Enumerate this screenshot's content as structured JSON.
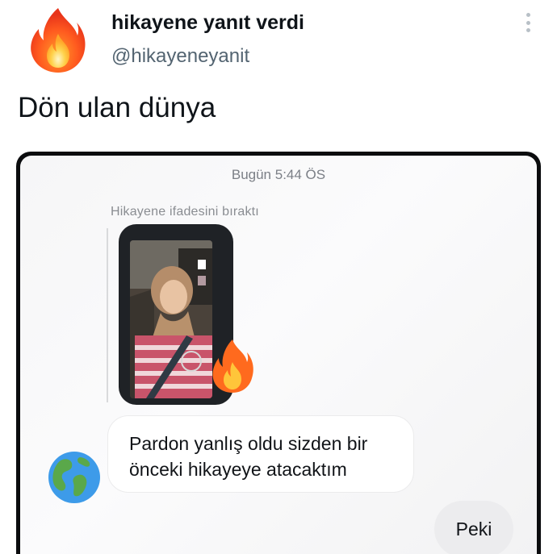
{
  "tweet": {
    "author_name": "hikayene yanıt verdi",
    "author_handle": "@hikayeneyanit",
    "avatar_icon": "fire-icon",
    "more_icon": "more-vertical-icon",
    "text": "Dön ulan dünya"
  },
  "chat": {
    "timestamp": "Bugün 5:44 ÖS",
    "story_reply_label": "Hikayene  ifadesini bıraktı",
    "story_reaction_icon": "fire-emoji-icon",
    "sender_avatar_icon": "earth-globe-icon",
    "incoming_message_lines": [
      "Pardon yanlış oldu sizden bir",
      "önceki hikayeye atacaktım"
    ],
    "outgoing_message": "Peki"
  }
}
